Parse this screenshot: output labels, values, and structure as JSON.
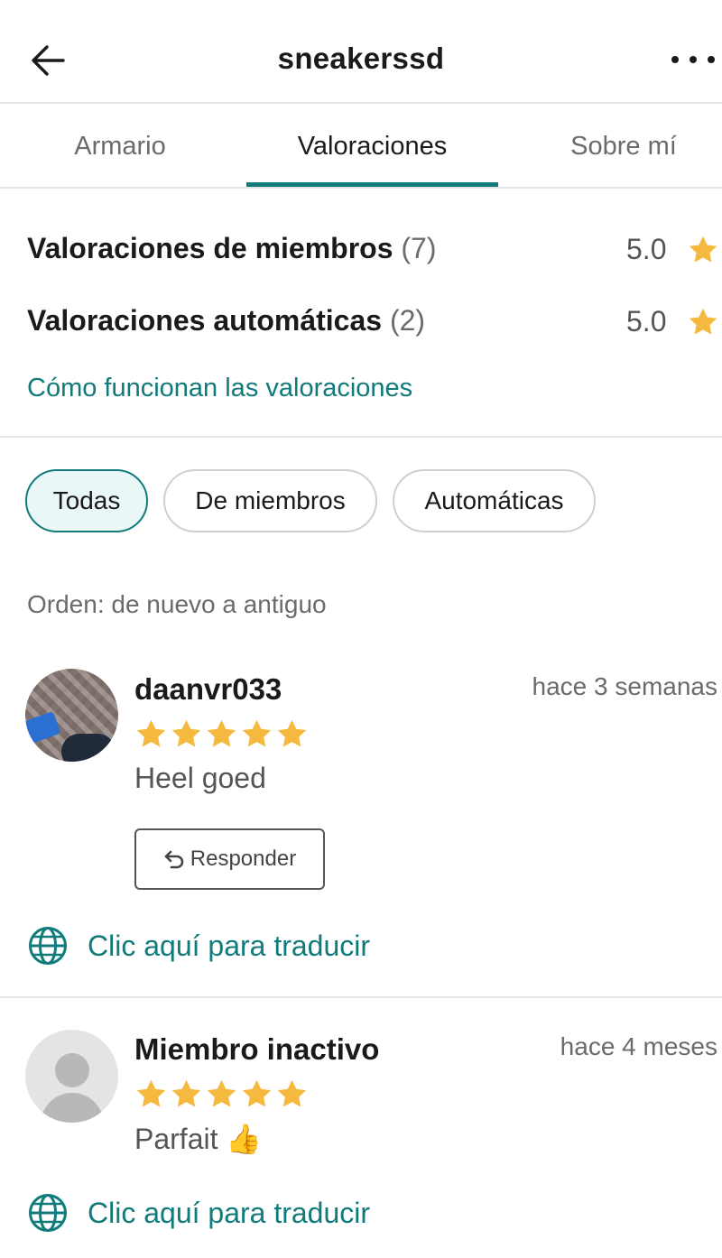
{
  "header": {
    "title": "sneakerssd",
    "back_icon": "arrow-left-icon",
    "more_icon": "more-horizontal-icon"
  },
  "tabs": [
    {
      "label": "Armario",
      "active": false
    },
    {
      "label": "Valoraciones",
      "active": true
    },
    {
      "label": "Sobre mí",
      "active": false
    }
  ],
  "summary": {
    "member": {
      "label": "Valoraciones de miembros",
      "count": "(7)",
      "score": "5.0"
    },
    "automatic": {
      "label": "Valoraciones automáticas",
      "count": "(2)",
      "score": "5.0"
    },
    "how_link": "Cómo funcionan las valoraciones"
  },
  "filters": [
    {
      "label": "Todas",
      "active": true
    },
    {
      "label": "De miembros",
      "active": false
    },
    {
      "label": "Automáticas",
      "active": false
    }
  ],
  "order_label": "Orden: de nuevo a antiguo",
  "reviews": [
    {
      "username": "daanvr033",
      "time": "hace 3 semanas",
      "rating": 5,
      "comment": "Heel goed",
      "reply_label": "Responder",
      "translate_label": "Clic aquí para traducir"
    },
    {
      "username": "Miembro inactivo",
      "time": "hace 4 meses",
      "rating": 5,
      "comment": "Parfait 👍",
      "translate_label": "Clic aquí para traducir"
    }
  ],
  "colors": {
    "accent": "#117a7a",
    "star": "#f5b93f",
    "divider": "#e6e6e6",
    "chip_active_bg": "#e9f7f7"
  }
}
